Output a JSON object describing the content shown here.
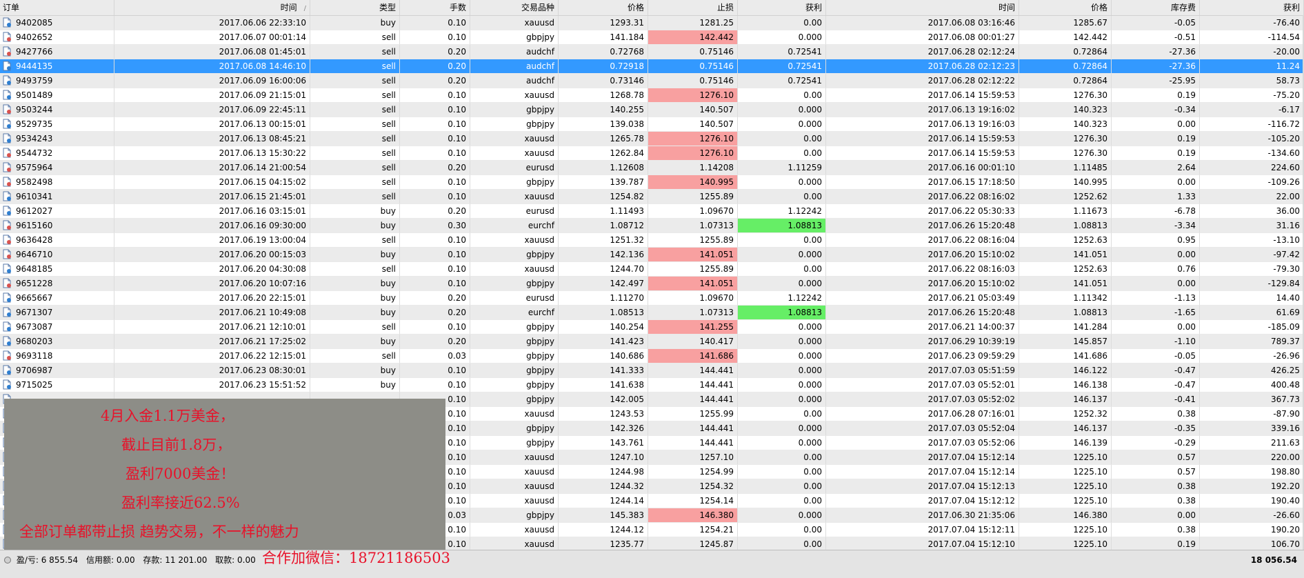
{
  "headers": [
    "订单",
    "时间",
    "类型",
    "手数",
    "交易品种",
    "价格",
    "止损",
    "获利",
    "时间",
    "价格",
    "库存费",
    "获利"
  ],
  "sort_indicator": "/",
  "rows": [
    {
      "order": "9402085",
      "open_time": "2017.06.06 22:33:10",
      "type": "buy",
      "lots": "0.10",
      "symbol": "xauusd",
      "open_price": "1293.31",
      "sl": "1281.25",
      "tp": "0.00",
      "close_time": "2017.06.08 03:16:46",
      "close_price": "1285.67",
      "swap": "-0.05",
      "profit": "-76.40"
    },
    {
      "order": "9402652",
      "open_time": "2017.06.07 00:01:14",
      "type": "sell",
      "lots": "0.10",
      "symbol": "gbpjpy",
      "open_price": "141.184",
      "sl": "142.442",
      "tp": "0.000",
      "close_time": "2017.06.08 00:01:27",
      "close_price": "142.442",
      "swap": "-0.51",
      "profit": "-114.54",
      "hl_sl": "red"
    },
    {
      "order": "9427766",
      "open_time": "2017.06.08 01:45:01",
      "type": "sell",
      "lots": "0.20",
      "symbol": "audchf",
      "open_price": "0.72768",
      "sl": "0.75146",
      "tp": "0.72541",
      "close_time": "2017.06.28 02:12:24",
      "close_price": "0.72864",
      "swap": "-27.36",
      "profit": "-20.00"
    },
    {
      "order": "9444135",
      "open_time": "2017.06.08 14:46:10",
      "type": "sell",
      "lots": "0.20",
      "symbol": "audchf",
      "open_price": "0.72918",
      "sl": "0.75146",
      "tp": "0.72541",
      "close_time": "2017.06.28 02:12:23",
      "close_price": "0.72864",
      "swap": "-27.36",
      "profit": "11.24",
      "selected": true
    },
    {
      "order": "9493759",
      "open_time": "2017.06.09 16:00:06",
      "type": "sell",
      "lots": "0.20",
      "symbol": "audchf",
      "open_price": "0.73146",
      "sl": "0.75146",
      "tp": "0.72541",
      "close_time": "2017.06.28 02:12:22",
      "close_price": "0.72864",
      "swap": "-25.95",
      "profit": "58.73"
    },
    {
      "order": "9501489",
      "open_time": "2017.06.09 21:15:01",
      "type": "sell",
      "lots": "0.10",
      "symbol": "xauusd",
      "open_price": "1268.78",
      "sl": "1276.10",
      "tp": "0.00",
      "close_time": "2017.06.14 15:59:53",
      "close_price": "1276.30",
      "swap": "0.19",
      "profit": "-75.20",
      "hl_sl": "red"
    },
    {
      "order": "9503244",
      "open_time": "2017.06.09 22:45:11",
      "type": "sell",
      "lots": "0.10",
      "symbol": "gbpjpy",
      "open_price": "140.255",
      "sl": "140.507",
      "tp": "0.000",
      "close_time": "2017.06.13 19:16:02",
      "close_price": "140.323",
      "swap": "-0.34",
      "profit": "-6.17"
    },
    {
      "order": "9529735",
      "open_time": "2017.06.13 00:15:01",
      "type": "sell",
      "lots": "0.10",
      "symbol": "gbpjpy",
      "open_price": "139.038",
      "sl": "140.507",
      "tp": "0.000",
      "close_time": "2017.06.13 19:16:03",
      "close_price": "140.323",
      "swap": "0.00",
      "profit": "-116.72"
    },
    {
      "order": "9534243",
      "open_time": "2017.06.13 08:45:21",
      "type": "sell",
      "lots": "0.10",
      "symbol": "xauusd",
      "open_price": "1265.78",
      "sl": "1276.10",
      "tp": "0.00",
      "close_time": "2017.06.14 15:59:53",
      "close_price": "1276.30",
      "swap": "0.19",
      "profit": "-105.20",
      "hl_sl": "red"
    },
    {
      "order": "9544732",
      "open_time": "2017.06.13 15:30:22",
      "type": "sell",
      "lots": "0.10",
      "symbol": "xauusd",
      "open_price": "1262.84",
      "sl": "1276.10",
      "tp": "0.00",
      "close_time": "2017.06.14 15:59:53",
      "close_price": "1276.30",
      "swap": "0.19",
      "profit": "-134.60",
      "hl_sl": "red"
    },
    {
      "order": "9575964",
      "open_time": "2017.06.14 21:00:54",
      "type": "sell",
      "lots": "0.20",
      "symbol": "eurusd",
      "open_price": "1.12608",
      "sl": "1.14208",
      "tp": "1.11259",
      "close_time": "2017.06.16 00:01:10",
      "close_price": "1.11485",
      "swap": "2.64",
      "profit": "224.60"
    },
    {
      "order": "9582498",
      "open_time": "2017.06.15 04:15:02",
      "type": "sell",
      "lots": "0.10",
      "symbol": "gbpjpy",
      "open_price": "139.787",
      "sl": "140.995",
      "tp": "0.000",
      "close_time": "2017.06.15 17:18:50",
      "close_price": "140.995",
      "swap": "0.00",
      "profit": "-109.26",
      "hl_sl": "red"
    },
    {
      "order": "9610341",
      "open_time": "2017.06.15 21:45:01",
      "type": "sell",
      "lots": "0.10",
      "symbol": "xauusd",
      "open_price": "1254.82",
      "sl": "1255.89",
      "tp": "0.00",
      "close_time": "2017.06.22 08:16:02",
      "close_price": "1252.62",
      "swap": "1.33",
      "profit": "22.00"
    },
    {
      "order": "9612027",
      "open_time": "2017.06.16 03:15:01",
      "type": "buy",
      "lots": "0.20",
      "symbol": "eurusd",
      "open_price": "1.11493",
      "sl": "1.09670",
      "tp": "1.12242",
      "close_time": "2017.06.22 05:30:33",
      "close_price": "1.11673",
      "swap": "-6.78",
      "profit": "36.00"
    },
    {
      "order": "9615160",
      "open_time": "2017.06.16 09:30:00",
      "type": "buy",
      "lots": "0.30",
      "symbol": "eurchf",
      "open_price": "1.08712",
      "sl": "1.07313",
      "tp": "1.08813",
      "close_time": "2017.06.26 15:20:48",
      "close_price": "1.08813",
      "swap": "-3.34",
      "profit": "31.16",
      "hl_tp": "green"
    },
    {
      "order": "9636428",
      "open_time": "2017.06.19 13:00:04",
      "type": "sell",
      "lots": "0.10",
      "symbol": "xauusd",
      "open_price": "1251.32",
      "sl": "1255.89",
      "tp": "0.00",
      "close_time": "2017.06.22 08:16:04",
      "close_price": "1252.63",
      "swap": "0.95",
      "profit": "-13.10"
    },
    {
      "order": "9646710",
      "open_time": "2017.06.20 00:15:03",
      "type": "buy",
      "lots": "0.10",
      "symbol": "gbpjpy",
      "open_price": "142.136",
      "sl": "141.051",
      "tp": "0.000",
      "close_time": "2017.06.20 15:10:02",
      "close_price": "141.051",
      "swap": "0.00",
      "profit": "-97.42",
      "hl_sl": "red"
    },
    {
      "order": "9648185",
      "open_time": "2017.06.20 04:30:08",
      "type": "sell",
      "lots": "0.10",
      "symbol": "xauusd",
      "open_price": "1244.70",
      "sl": "1255.89",
      "tp": "0.00",
      "close_time": "2017.06.22 08:16:03",
      "close_price": "1252.63",
      "swap": "0.76",
      "profit": "-79.30"
    },
    {
      "order": "9651228",
      "open_time": "2017.06.20 10:07:16",
      "type": "buy",
      "lots": "0.10",
      "symbol": "gbpjpy",
      "open_price": "142.497",
      "sl": "141.051",
      "tp": "0.000",
      "close_time": "2017.06.20 15:10:02",
      "close_price": "141.051",
      "swap": "0.00",
      "profit": "-129.84",
      "hl_sl": "red"
    },
    {
      "order": "9665667",
      "open_time": "2017.06.20 22:15:01",
      "type": "buy",
      "lots": "0.20",
      "symbol": "eurusd",
      "open_price": "1.11270",
      "sl": "1.09670",
      "tp": "1.12242",
      "close_time": "2017.06.21 05:03:49",
      "close_price": "1.11342",
      "swap": "-1.13",
      "profit": "14.40"
    },
    {
      "order": "9671307",
      "open_time": "2017.06.21 10:49:08",
      "type": "buy",
      "lots": "0.20",
      "symbol": "eurchf",
      "open_price": "1.08513",
      "sl": "1.07313",
      "tp": "1.08813",
      "close_time": "2017.06.26 15:20:48",
      "close_price": "1.08813",
      "swap": "-1.65",
      "profit": "61.69",
      "hl_tp": "green"
    },
    {
      "order": "9673087",
      "open_time": "2017.06.21 12:10:01",
      "type": "sell",
      "lots": "0.10",
      "symbol": "gbpjpy",
      "open_price": "140.254",
      "sl": "141.255",
      "tp": "0.000",
      "close_time": "2017.06.21 14:00:37",
      "close_price": "141.284",
      "swap": "0.00",
      "profit": "-185.09",
      "hl_sl": "red"
    },
    {
      "order": "9680203",
      "open_time": "2017.06.21 17:25:02",
      "type": "buy",
      "lots": "0.20",
      "symbol": "gbpjpy",
      "open_price": "141.423",
      "sl": "140.417",
      "tp": "0.000",
      "close_time": "2017.06.29 10:39:19",
      "close_price": "145.857",
      "swap": "-1.10",
      "profit": "789.37"
    },
    {
      "order": "9693118",
      "open_time": "2017.06.22 12:15:01",
      "type": "sell",
      "lots": "0.03",
      "symbol": "gbpjpy",
      "open_price": "140.686",
      "sl": "141.686",
      "tp": "0.000",
      "close_time": "2017.06.23 09:59:29",
      "close_price": "141.686",
      "swap": "-0.05",
      "profit": "-26.96",
      "hl_sl": "red"
    },
    {
      "order": "9706987",
      "open_time": "2017.06.23 08:30:01",
      "type": "buy",
      "lots": "0.10",
      "symbol": "gbpjpy",
      "open_price": "141.333",
      "sl": "144.441",
      "tp": "0.000",
      "close_time": "2017.07.03 05:51:59",
      "close_price": "146.122",
      "swap": "-0.47",
      "profit": "426.25"
    },
    {
      "order": "9715025",
      "open_time": "2017.06.23 15:51:52",
      "type": "buy",
      "lots": "0.10",
      "symbol": "gbpjpy",
      "open_price": "141.638",
      "sl": "144.441",
      "tp": "0.000",
      "close_time": "2017.07.03 05:52:01",
      "close_price": "146.138",
      "swap": "-0.47",
      "profit": "400.48"
    },
    {
      "order": "",
      "open_time": "",
      "type": "",
      "lots": "0.10",
      "symbol": "gbpjpy",
      "open_price": "142.005",
      "sl": "144.441",
      "tp": "0.000",
      "close_time": "2017.07.03 05:52:02",
      "close_price": "146.137",
      "swap": "-0.41",
      "profit": "367.73"
    },
    {
      "order": "",
      "open_time": "",
      "type": "",
      "lots": "0.10",
      "symbol": "xauusd",
      "open_price": "1243.53",
      "sl": "1255.99",
      "tp": "0.00",
      "close_time": "2017.06.28 07:16:01",
      "close_price": "1252.32",
      "swap": "0.38",
      "profit": "-87.90"
    },
    {
      "order": "",
      "open_time": "",
      "type": "",
      "lots": "0.10",
      "symbol": "gbpjpy",
      "open_price": "142.326",
      "sl": "144.441",
      "tp": "0.000",
      "close_time": "2017.07.03 05:52:04",
      "close_price": "146.137",
      "swap": "-0.35",
      "profit": "339.16"
    },
    {
      "order": "",
      "open_time": "",
      "type": "",
      "lots": "0.10",
      "symbol": "gbpjpy",
      "open_price": "143.761",
      "sl": "144.441",
      "tp": "0.000",
      "close_time": "2017.07.03 05:52:06",
      "close_price": "146.139",
      "swap": "-0.29",
      "profit": "211.63"
    },
    {
      "order": "",
      "open_time": "",
      "type": "",
      "lots": "0.10",
      "symbol": "xauusd",
      "open_price": "1247.10",
      "sl": "1257.10",
      "tp": "0.00",
      "close_time": "2017.07.04 15:12:14",
      "close_price": "1225.10",
      "swap": "0.57",
      "profit": "220.00"
    },
    {
      "order": "",
      "open_time": "",
      "type": "",
      "lots": "0.10",
      "symbol": "xauusd",
      "open_price": "1244.98",
      "sl": "1254.99",
      "tp": "0.00",
      "close_time": "2017.07.04 15:12:14",
      "close_price": "1225.10",
      "swap": "0.57",
      "profit": "198.80"
    },
    {
      "order": "",
      "open_time": "",
      "type": "",
      "lots": "0.10",
      "symbol": "xauusd",
      "open_price": "1244.32",
      "sl": "1254.32",
      "tp": "0.00",
      "close_time": "2017.07.04 15:12:13",
      "close_price": "1225.10",
      "swap": "0.38",
      "profit": "192.20"
    },
    {
      "order": "",
      "open_time": "",
      "type": "",
      "lots": "0.10",
      "symbol": "xauusd",
      "open_price": "1244.14",
      "sl": "1254.14",
      "tp": "0.00",
      "close_time": "2017.07.04 15:12:12",
      "close_price": "1225.10",
      "swap": "0.38",
      "profit": "190.40"
    },
    {
      "order": "",
      "open_time": "",
      "type": "",
      "lots": "0.03",
      "symbol": "gbpjpy",
      "open_price": "145.383",
      "sl": "146.380",
      "tp": "0.000",
      "close_time": "2017.06.30 21:35:06",
      "close_price": "146.380",
      "swap": "0.00",
      "profit": "-26.60",
      "hl_sl": "red"
    },
    {
      "order": "",
      "open_time": "",
      "type": "",
      "lots": "0.10",
      "symbol": "xauusd",
      "open_price": "1244.12",
      "sl": "1254.21",
      "tp": "0.00",
      "close_time": "2017.07.04 15:12:11",
      "close_price": "1225.10",
      "swap": "0.38",
      "profit": "190.20"
    },
    {
      "order": "",
      "open_time": "",
      "type": "",
      "lots": "0.10",
      "symbol": "xauusd",
      "open_price": "1235.77",
      "sl": "1245.87",
      "tp": "0.00",
      "close_time": "2017.07.04 15:12:10",
      "close_price": "1225.10",
      "swap": "0.19",
      "profit": "106.70"
    }
  ],
  "status_bar": {
    "pl": "盈/亏: 6 855.54",
    "credit": "信用额: 0.00",
    "deposit": "存款: 11 201.00",
    "withdrawal": "取款: 0.00",
    "total": "18 056.54"
  },
  "overlay": {
    "lines": [
      "4月入金1.1万美金，",
      "截止目前1.8万，",
      "盈利7000美金！",
      "盈利率接近62.5%",
      "全部订单都带止损  趋势交易，不一样的魅力"
    ],
    "wechat": "合作加微信：18721186503"
  },
  "colors": {
    "selected_row": "#3399ff",
    "sl_highlight": "#f8a0a0",
    "tp_highlight": "#66ee66",
    "overlay_text": "#e8122a",
    "overlay_bg": "#8d8d87"
  }
}
